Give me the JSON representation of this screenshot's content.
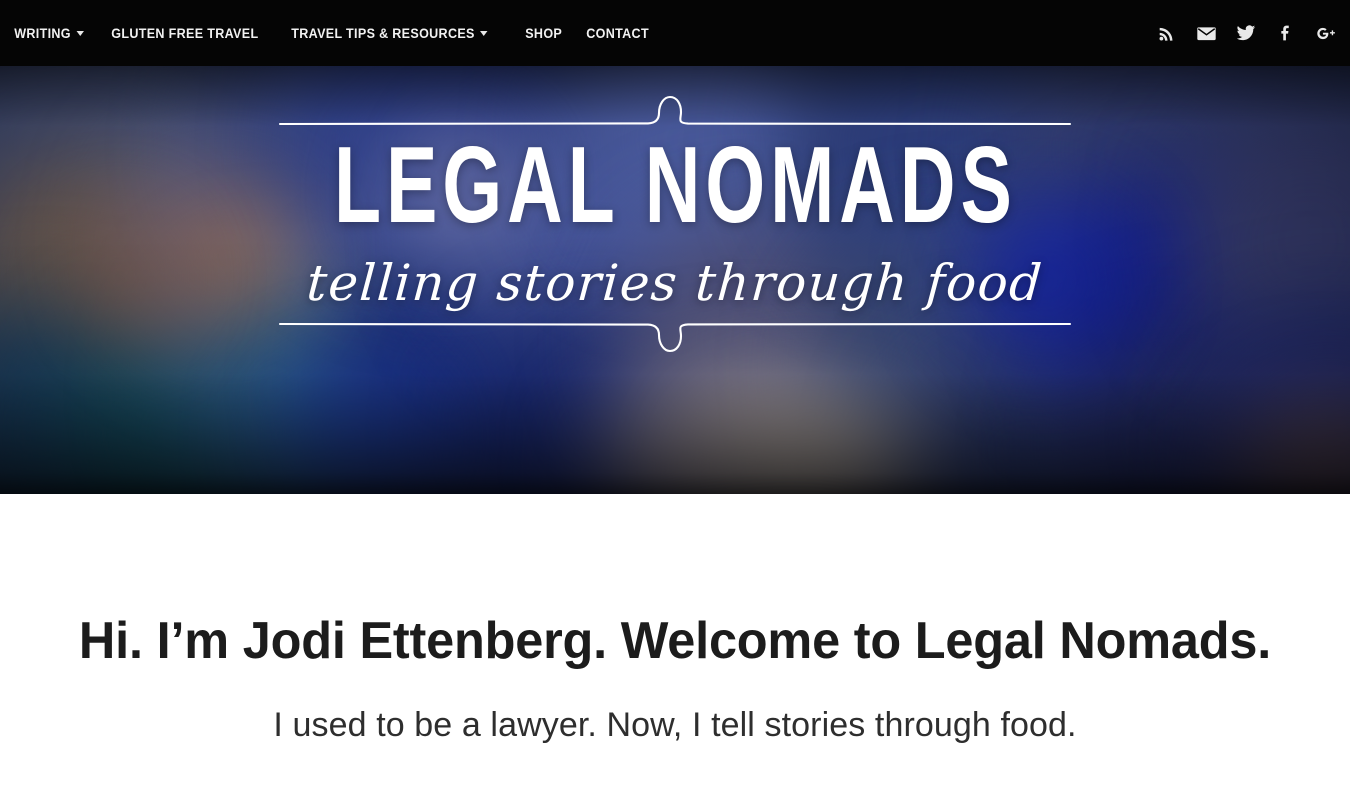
{
  "nav": {
    "items": [
      {
        "label": "WRITING",
        "has_dropdown": true
      },
      {
        "label": "GLUTEN FREE TRAVEL",
        "has_dropdown": false
      },
      {
        "label": "TRAVEL TIPS & RESOURCES",
        "has_dropdown": true
      },
      {
        "label": "SHOP",
        "has_dropdown": false
      },
      {
        "label": "CONTACT",
        "has_dropdown": false
      }
    ],
    "background_color": "#050505",
    "text_color": "#f2f2f2"
  },
  "social": {
    "links": [
      {
        "name": "rss-icon",
        "label": "RSS"
      },
      {
        "name": "email-icon",
        "label": "Email"
      },
      {
        "name": "twitter-icon",
        "label": "Twitter"
      },
      {
        "name": "facebook-icon",
        "label": "Facebook"
      },
      {
        "name": "google-plus-icon",
        "label": "Google Plus"
      }
    ]
  },
  "hero": {
    "logo": "LEGAL NOMADS",
    "tagline": "telling stories through food",
    "background_description": "blurred photograph of colorful ceramic bowls",
    "accent_color": "#ffffff",
    "base_color": "#2d3a63"
  },
  "main": {
    "headline": "Hi. I’m Jodi Ettenberg. Welcome to Legal Nomads.",
    "subheadline": "I used to be a lawyer. Now, I tell stories through food.",
    "headline_color": "#1c1c1c",
    "background_color": "#ffffff"
  }
}
